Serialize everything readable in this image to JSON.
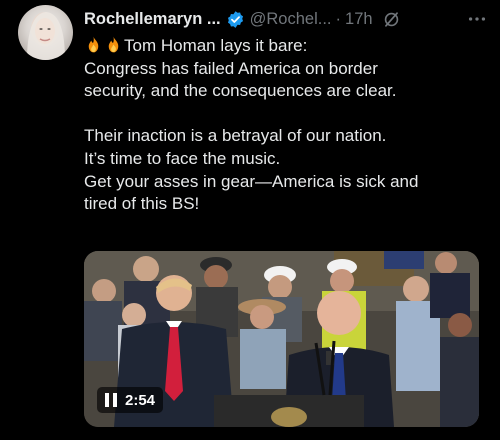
{
  "author": {
    "display_name": "Rochellemaryn ...",
    "handle": "@Rochel...",
    "separator": "·",
    "timestamp": "17h",
    "verified_color": "#1d9bf0"
  },
  "tweet": {
    "line1": "Tom Homan lays it bare:",
    "line2": "Congress has failed America on border",
    "line3": "security, and the consequences are clear.",
    "line4": "Their inaction is a betrayal of our nation.",
    "line5": "It’s time to face the music.",
    "line6": "Get your asses in gear—America is sick and",
    "line7": "tired of this BS!",
    "leading_emoji": [
      "fire-icon",
      "fire-icon"
    ]
  },
  "media": {
    "type": "video",
    "duration": "2:54",
    "state": "playing"
  },
  "icons": {
    "verified": "verified-badge-icon",
    "grok": "grok-icon",
    "more": "more-options-icon",
    "pause": "pause-icon"
  }
}
